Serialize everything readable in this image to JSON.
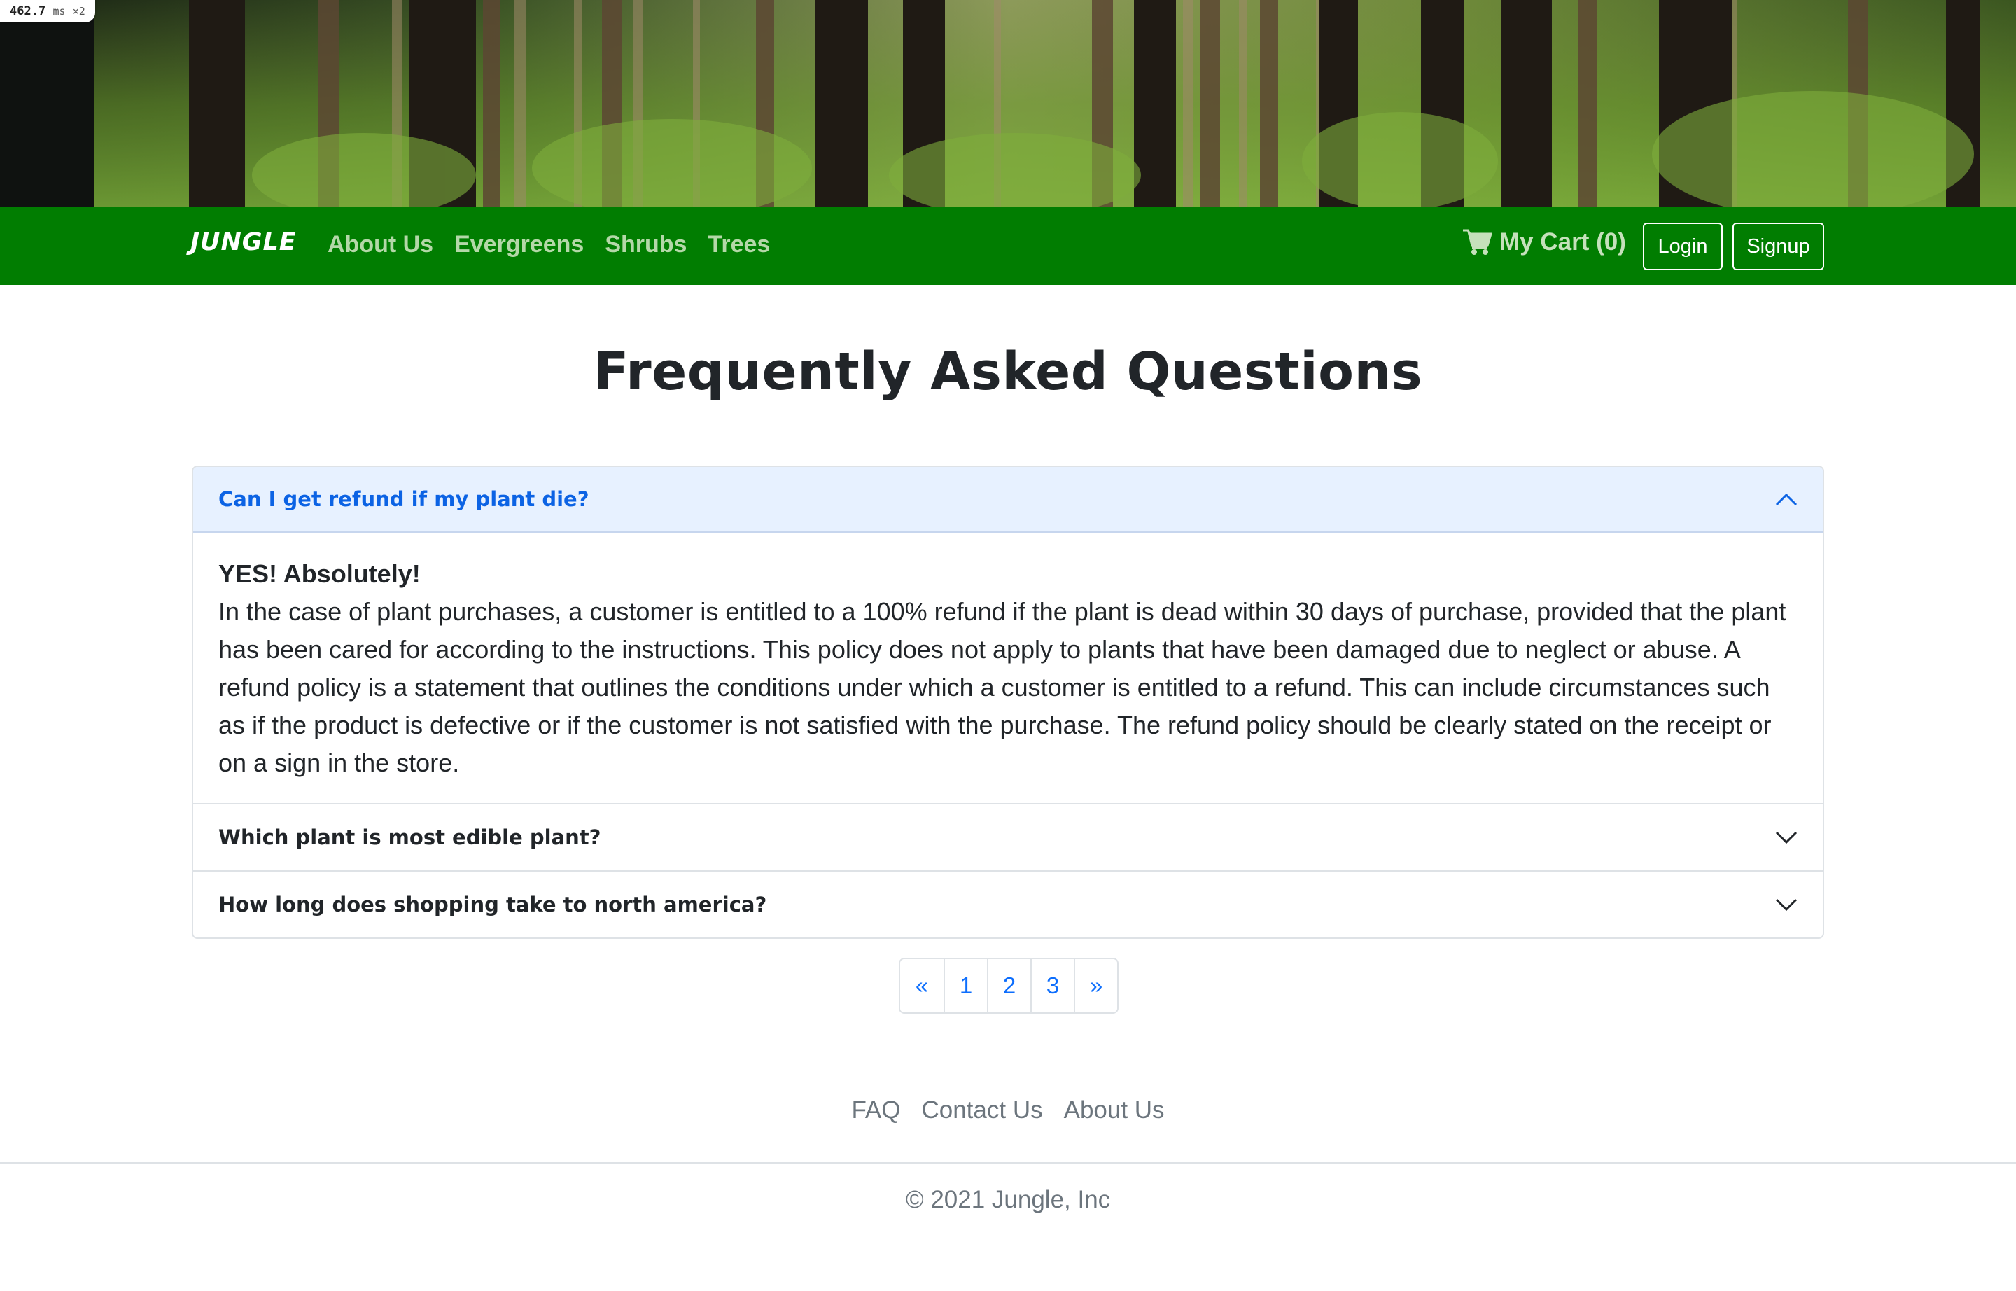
{
  "timing_badge": {
    "value": "462.7",
    "unit": "ms",
    "multiplier": "×2"
  },
  "navbar": {
    "brand": "JUNGLE",
    "links": [
      "About Us",
      "Evergreens",
      "Shrubs",
      "Trees"
    ],
    "cart_label": "My Cart (0)",
    "login_label": "Login",
    "signup_label": "Signup",
    "background_color": "#017d01"
  },
  "page_title": "Frequently Asked Questions",
  "faq": [
    {
      "question": "Can I get refund if my plant die?",
      "expanded": true,
      "answer_title": "YES! Absolutely!",
      "answer_text": "In the case of plant purchases, a customer is entitled to a 100% refund if the plant is dead within 30 days of purchase, provided that the plant has been cared for according to the instructions. This policy does not apply to plants that have been damaged due to neglect or abuse. A refund policy is a statement that outlines the conditions under which a customer is entitled to a refund. This can include circumstances such as if the product is defective or if the customer is not satisfied with the purchase. The refund policy should be clearly stated on the receipt or on a sign in the store."
    },
    {
      "question": "Which plant is most edible plant?",
      "expanded": false
    },
    {
      "question": "How long does shopping take to north america?",
      "expanded": false
    }
  ],
  "pagination": {
    "prev": "«",
    "pages": [
      "1",
      "2",
      "3"
    ],
    "next": "»"
  },
  "footer": {
    "links": [
      "FAQ",
      "Contact Us",
      "About Us"
    ],
    "copyright": "© 2021 Jungle, Inc"
  },
  "icons": {
    "cart": "shopping-cart-icon",
    "expanded_chevron": "chevron-up-icon",
    "collapsed_chevron": "chevron-down-icon"
  }
}
